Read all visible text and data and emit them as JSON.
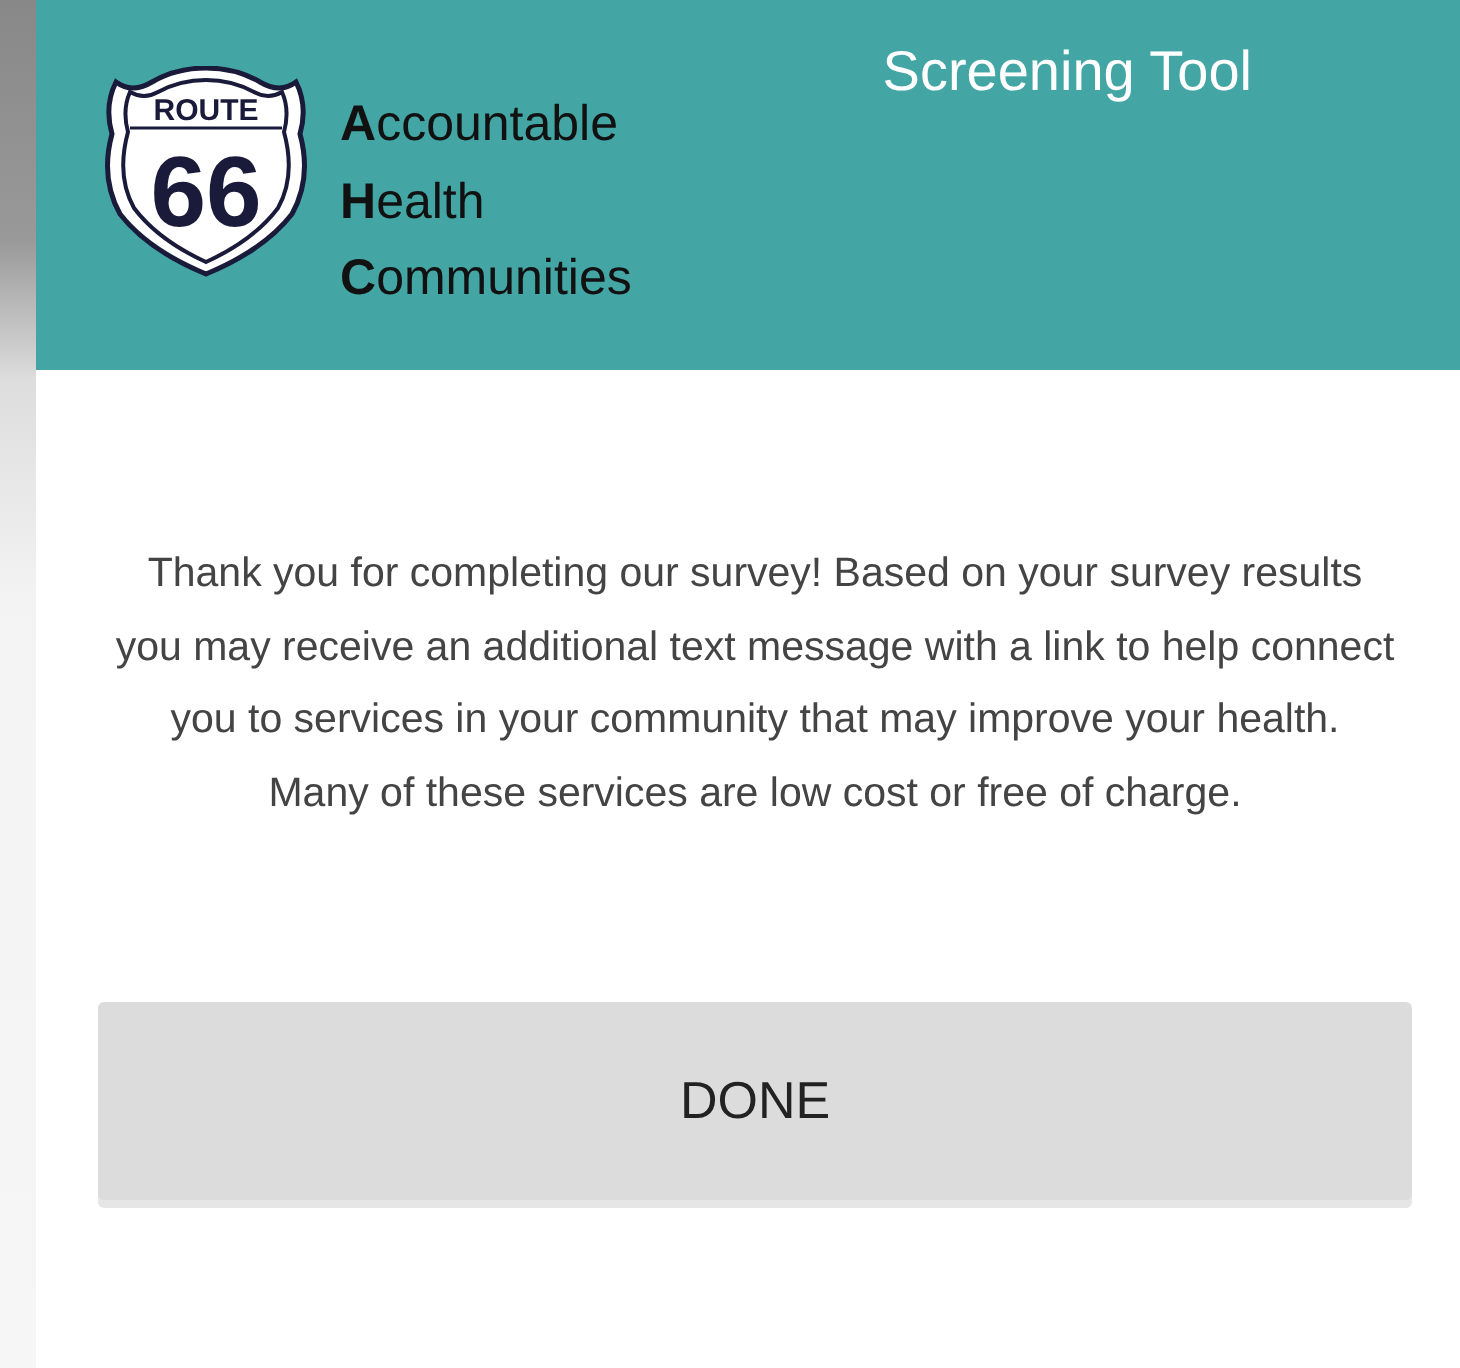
{
  "header": {
    "logo": {
      "shield_top": "ROUTE",
      "shield_number": "66",
      "name_lines": [
        "**A**ccountable",
        "**H**ealth",
        "**C**ommunities"
      ]
    },
    "title": "Screening Tool"
  },
  "message": "Thank you for completing our survey! Based on your survey results you may receive an additional text message with a link to help connect you to services in your community that may improve your health. Many of these services are low cost or free of charge.",
  "buttons": [
    {
      "label": "DONE"
    }
  ]
}
